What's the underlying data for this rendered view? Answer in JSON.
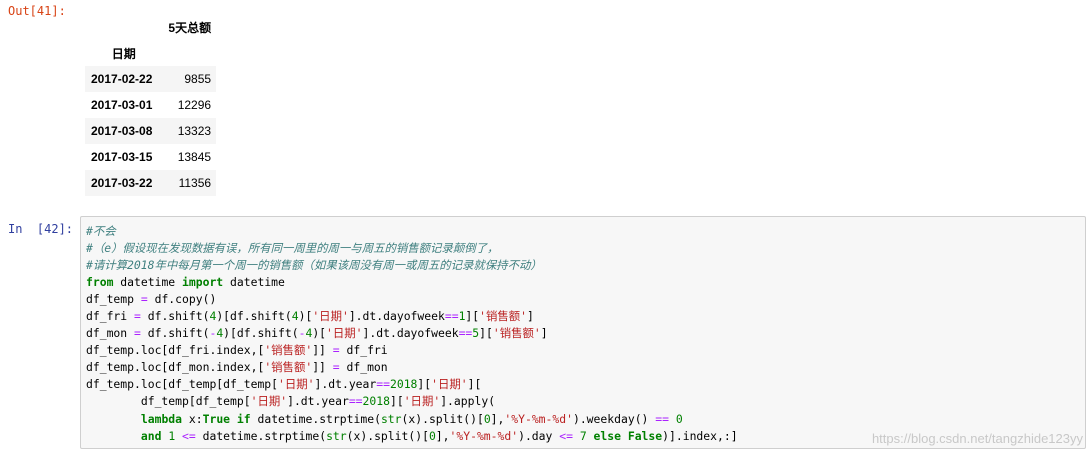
{
  "output_prompt": "Out[41]:",
  "input_prompt": "In  [42]:",
  "dataframe": {
    "column_header": "5天总额",
    "index_header": "日期",
    "rows": [
      {
        "date": "2017-02-22",
        "value": "9855"
      },
      {
        "date": "2017-03-01",
        "value": "12296"
      },
      {
        "date": "2017-03-08",
        "value": "13323"
      },
      {
        "date": "2017-03-15",
        "value": "13845"
      },
      {
        "date": "2017-03-22",
        "value": "11356"
      }
    ]
  },
  "code_lines": [
    [
      {
        "t": "#不会",
        "c": "cm"
      }
    ],
    [
      {
        "t": "#（e）假设现在发现数据有误，所有同一周里的周一与周五的销售额记录颠倒了，",
        "c": "cm"
      }
    ],
    [
      {
        "t": "#请计算2018年中每月第一个周一的销售额（如果该周没有周一或周五的记录就保持不动）",
        "c": "cm"
      }
    ],
    [
      {
        "t": "from",
        "c": "kw"
      },
      {
        "t": " datetime "
      },
      {
        "t": "import",
        "c": "kw"
      },
      {
        "t": " datetime"
      }
    ],
    [
      {
        "t": "df_temp "
      },
      {
        "t": "=",
        "c": "op"
      },
      {
        "t": " df.copy()"
      }
    ],
    [
      {
        "t": "df_fri "
      },
      {
        "t": "=",
        "c": "op"
      },
      {
        "t": " df.shift("
      },
      {
        "t": "4",
        "c": "nm"
      },
      {
        "t": ")[df.shift("
      },
      {
        "t": "4",
        "c": "nm"
      },
      {
        "t": ")["
      },
      {
        "t": "'日期'",
        "c": "st"
      },
      {
        "t": "].dt.dayofweek"
      },
      {
        "t": "==",
        "c": "op"
      },
      {
        "t": "1",
        "c": "nm"
      },
      {
        "t": "]["
      },
      {
        "t": "'销售额'",
        "c": "st"
      },
      {
        "t": "]"
      }
    ],
    [
      {
        "t": "df_mon "
      },
      {
        "t": "=",
        "c": "op"
      },
      {
        "t": " df.shift("
      },
      {
        "t": "-",
        "c": "op"
      },
      {
        "t": "4",
        "c": "nm"
      },
      {
        "t": ")[df.shift("
      },
      {
        "t": "-",
        "c": "op"
      },
      {
        "t": "4",
        "c": "nm"
      },
      {
        "t": ")["
      },
      {
        "t": "'日期'",
        "c": "st"
      },
      {
        "t": "].dt.dayofweek"
      },
      {
        "t": "==",
        "c": "op"
      },
      {
        "t": "5",
        "c": "nm"
      },
      {
        "t": "]["
      },
      {
        "t": "'销售额'",
        "c": "st"
      },
      {
        "t": "]"
      }
    ],
    [
      {
        "t": "df_temp.loc[df_fri.index,["
      },
      {
        "t": "'销售额'",
        "c": "st"
      },
      {
        "t": "]] "
      },
      {
        "t": "=",
        "c": "op"
      },
      {
        "t": " df_fri"
      }
    ],
    [
      {
        "t": "df_temp.loc[df_mon.index,["
      },
      {
        "t": "'销售额'",
        "c": "st"
      },
      {
        "t": "]] "
      },
      {
        "t": "=",
        "c": "op"
      },
      {
        "t": " df_mon"
      }
    ],
    [
      {
        "t": "df_temp.loc[df_temp[df_temp["
      },
      {
        "t": "'日期'",
        "c": "st"
      },
      {
        "t": "].dt.year"
      },
      {
        "t": "==",
        "c": "op"
      },
      {
        "t": "2018",
        "c": "nm"
      },
      {
        "t": "]["
      },
      {
        "t": "'日期'",
        "c": "st"
      },
      {
        "t": "]["
      }
    ],
    [
      {
        "t": "        df_temp[df_temp["
      },
      {
        "t": "'日期'",
        "c": "st"
      },
      {
        "t": "].dt.year"
      },
      {
        "t": "==",
        "c": "op"
      },
      {
        "t": "2018",
        "c": "nm"
      },
      {
        "t": "]["
      },
      {
        "t": "'日期'",
        "c": "st"
      },
      {
        "t": "].apply("
      }
    ],
    [
      {
        "t": "        "
      },
      {
        "t": "lambda",
        "c": "kw"
      },
      {
        "t": " x:"
      },
      {
        "t": "True",
        "c": "kw"
      },
      {
        "t": " "
      },
      {
        "t": "if",
        "c": "kw"
      },
      {
        "t": " datetime.strptime("
      },
      {
        "t": "str",
        "c": "bi"
      },
      {
        "t": "(x).split()["
      },
      {
        "t": "0",
        "c": "nm"
      },
      {
        "t": "],"
      },
      {
        "t": "'%Y-%m-%d'",
        "c": "st"
      },
      {
        "t": ").weekday() "
      },
      {
        "t": "==",
        "c": "op"
      },
      {
        "t": " "
      },
      {
        "t": "0",
        "c": "nm"
      }
    ],
    [
      {
        "t": "        "
      },
      {
        "t": "and",
        "c": "kw"
      },
      {
        "t": " "
      },
      {
        "t": "1",
        "c": "nm"
      },
      {
        "t": " "
      },
      {
        "t": "<=",
        "c": "op"
      },
      {
        "t": " datetime.strptime("
      },
      {
        "t": "str",
        "c": "bi"
      },
      {
        "t": "(x).split()["
      },
      {
        "t": "0",
        "c": "nm"
      },
      {
        "t": "],"
      },
      {
        "t": "'%Y-%m-%d'",
        "c": "st"
      },
      {
        "t": ").day "
      },
      {
        "t": "<=",
        "c": "op"
      },
      {
        "t": " "
      },
      {
        "t": "7",
        "c": "nm"
      },
      {
        "t": " "
      },
      {
        "t": "else",
        "c": "kw"
      },
      {
        "t": " "
      },
      {
        "t": "False",
        "c": "kw"
      },
      {
        "t": ")].index,:]"
      }
    ]
  ],
  "watermark": "https://blog.csdn.net/tangzhide123yy"
}
